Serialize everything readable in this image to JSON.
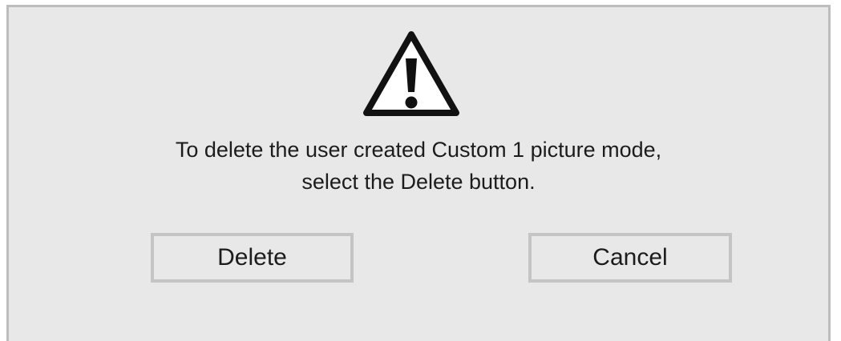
{
  "dialog": {
    "icon": "warning-triangle-icon",
    "message_line1": "To delete the user created Custom 1 picture mode,",
    "message_line2": "select the Delete button.",
    "delete_label": "Delete",
    "cancel_label": "Cancel"
  },
  "colors": {
    "background": "#e8e8e8",
    "border": "#bdbdbd",
    "text": "#1c1c1c"
  }
}
